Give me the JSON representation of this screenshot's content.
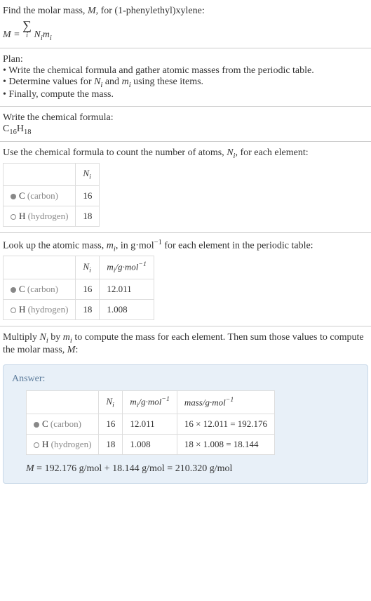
{
  "intro": {
    "line1_prefix": "Find the molar mass, ",
    "line1_var": "M",
    "line1_suffix": ", for (1-phenylethyl)xylene:",
    "formula_lhs": "M",
    "formula_eq": " = ",
    "sigma": "∑",
    "sigma_index": "i",
    "formula_rhs_n": "N",
    "formula_rhs_i1": "i",
    "formula_rhs_m": "m",
    "formula_rhs_i2": "i"
  },
  "plan": {
    "heading": "Plan:",
    "bullet1_prefix": "• Write the chemical formula and gather atomic masses from the periodic table.",
    "bullet2_prefix": "• Determine values for ",
    "bullet2_n": "N",
    "bullet2_i1": "i",
    "bullet2_and": " and ",
    "bullet2_m": "m",
    "bullet2_i2": "i",
    "bullet2_suffix": " using these items.",
    "bullet3": "• Finally, compute the mass."
  },
  "chemformula": {
    "heading": "Write the chemical formula:",
    "c": "C",
    "c_n": "16",
    "h": "H",
    "h_n": "18"
  },
  "count": {
    "heading_prefix": "Use the chemical formula to count the number of atoms, ",
    "heading_n": "N",
    "heading_i": "i",
    "heading_suffix": ", for each element:",
    "col_n": "N",
    "col_i": "i",
    "rows": [
      {
        "dot": "filled",
        "symbol": "C",
        "name": " (carbon)",
        "n": "16"
      },
      {
        "dot": "empty",
        "symbol": "H",
        "name": " (hydrogen)",
        "n": "18"
      }
    ]
  },
  "atomic": {
    "heading_prefix": "Look up the atomic mass, ",
    "heading_m": "m",
    "heading_i": "i",
    "heading_mid": ", in g·mol",
    "heading_exp": "−1",
    "heading_suffix": " for each element in the periodic table:",
    "col_n": "N",
    "col_ni": "i",
    "col_m": "m",
    "col_mi": "i",
    "col_unit": "/g·mol",
    "col_exp": "−1",
    "rows": [
      {
        "dot": "filled",
        "symbol": "C",
        "name": " (carbon)",
        "n": "16",
        "m": "12.011"
      },
      {
        "dot": "empty",
        "symbol": "H",
        "name": " (hydrogen)",
        "n": "18",
        "m": "1.008"
      }
    ]
  },
  "multiply": {
    "heading_prefix": "Multiply ",
    "n": "N",
    "ni": "i",
    "by": " by ",
    "m": "m",
    "mi": "i",
    "suffix": " to compute the mass for each element. Then sum those values to compute the molar mass, ",
    "mvar": "M",
    "colon": ":"
  },
  "answer": {
    "label": "Answer:",
    "col_n": "N",
    "col_ni": "i",
    "col_m": "m",
    "col_mi": "i",
    "col_munit": "/g·mol",
    "col_mexp": "−1",
    "col_mass": "mass/g·mol",
    "col_massexp": "−1",
    "rows": [
      {
        "dot": "filled",
        "symbol": "C",
        "name": " (carbon)",
        "n": "16",
        "m": "12.011",
        "mass": "16 × 12.011 = 192.176"
      },
      {
        "dot": "empty",
        "symbol": "H",
        "name": " (hydrogen)",
        "n": "18",
        "m": "1.008",
        "mass": "18 × 1.008 = 18.144"
      }
    ],
    "final_m": "M",
    "final_eq": " = 192.176 g/mol + 18.144 g/mol = 210.320 g/mol"
  },
  "chart_data": {
    "type": "table",
    "title": "Molar mass calculation for (1-phenylethyl)xylene C16H18",
    "elements": [
      {
        "element": "C (carbon)",
        "N_i": 16,
        "m_i_g_per_mol": 12.011,
        "mass_g_per_mol": 192.176
      },
      {
        "element": "H (hydrogen)",
        "N_i": 18,
        "m_i_g_per_mol": 1.008,
        "mass_g_per_mol": 18.144
      }
    ],
    "molar_mass_g_per_mol": 210.32
  }
}
